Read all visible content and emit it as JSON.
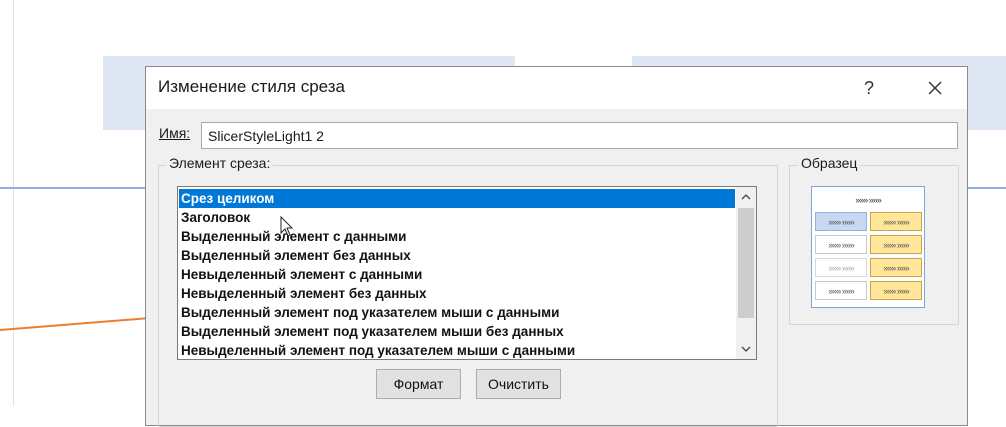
{
  "dialog": {
    "title": "Изменение стиля среза",
    "help_label": "?",
    "close_label": "✕"
  },
  "name_field": {
    "label": "Имя:",
    "value": "SlicerStyleLight1 2"
  },
  "elements": {
    "group_label": "Элемент среза:",
    "items": [
      {
        "label": "Срез целиком",
        "selected": true
      },
      {
        "label": "Заголовок",
        "selected": false
      },
      {
        "label": "Выделенный элемент с данными",
        "selected": false
      },
      {
        "label": "Выделенный элемент без данных",
        "selected": false
      },
      {
        "label": "Невыделенный элемент с данными",
        "selected": false
      },
      {
        "label": "Невыделенный элемент без данных",
        "selected": false
      },
      {
        "label": "Выделенный элемент под указателем мыши с данными",
        "selected": false
      },
      {
        "label": "Выделенный элемент под указателем мыши без данных",
        "selected": false
      },
      {
        "label": "Невыделенный элемент под указателем мыши с данными",
        "selected": false
      }
    ]
  },
  "buttons": {
    "format_label": "Формат",
    "clear_label": "Очистить"
  },
  "sample": {
    "group_label": "Образец",
    "cell_text": "»»» »»»"
  },
  "colors": {
    "selection": "#0078d7",
    "sample_blue": "#c6d9f1",
    "sample_yellow": "#ffe699",
    "chart_blue_line": "#4472c4",
    "chart_orange_line": "#ed7d31"
  }
}
